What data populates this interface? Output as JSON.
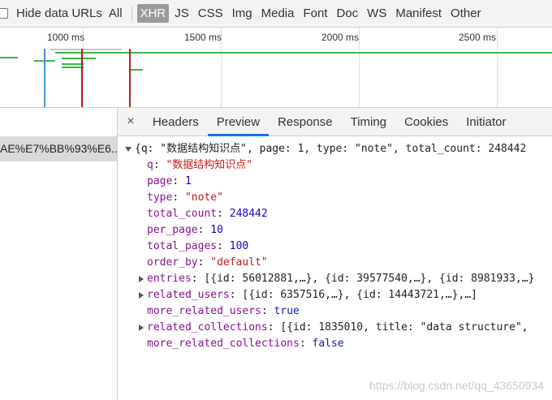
{
  "filter_bar": {
    "hide_data_urls_label": "Hide data URLs",
    "types": [
      "All",
      "XHR",
      "JS",
      "CSS",
      "Img",
      "Media",
      "Font",
      "Doc",
      "WS",
      "Manifest",
      "Other"
    ],
    "active_type": "XHR"
  },
  "timeline": {
    "ticks": [
      "1000 ms",
      "1500 ms",
      "2000 ms",
      "2500 ms"
    ],
    "colors": {
      "green": "#3bb84a",
      "blue": "#4a90d9",
      "red": "#b22222",
      "gray": "#c8c8c8"
    }
  },
  "request_list": {
    "selected_name": "AE%E7%BB%93%E6..."
  },
  "detail_tabs": {
    "close_symbol": "×",
    "tabs": [
      "Headers",
      "Preview",
      "Response",
      "Timing",
      "Cookies",
      "Initiator"
    ],
    "active_tab": "Preview"
  },
  "preview": {
    "summary": "{q: \"数据结构知识点\", page: 1, type: \"note\", total_count: 248442",
    "fields": [
      {
        "key": "q",
        "value": "\"数据结构知识点\"",
        "kind": "str"
      },
      {
        "key": "page",
        "value": "1",
        "kind": "num"
      },
      {
        "key": "type",
        "value": "\"note\"",
        "kind": "str"
      },
      {
        "key": "total_count",
        "value": "248442",
        "kind": "num"
      },
      {
        "key": "per_page",
        "value": "10",
        "kind": "num"
      },
      {
        "key": "total_pages",
        "value": "100",
        "kind": "num"
      },
      {
        "key": "order_by",
        "value": "\"default\"",
        "kind": "str"
      },
      {
        "key": "entries",
        "value": "[{id: 56012881,…}, {id: 39577540,…}, {id: 8981933,…}",
        "kind": "plain",
        "expandable": true
      },
      {
        "key": "related_users",
        "value": "[{id: 6357516,…}, {id: 14443721,…},…]",
        "kind": "plain",
        "expandable": true
      },
      {
        "key": "more_related_users",
        "value": "true",
        "kind": "bool"
      },
      {
        "key": "related_collections",
        "value": "[{id: 1835010, title: \"data structure\",",
        "kind": "plain",
        "expandable": true
      },
      {
        "key": "more_related_collections",
        "value": "false",
        "kind": "bool"
      }
    ]
  },
  "watermark": "https://blog.csdn.net/qq_43650934"
}
